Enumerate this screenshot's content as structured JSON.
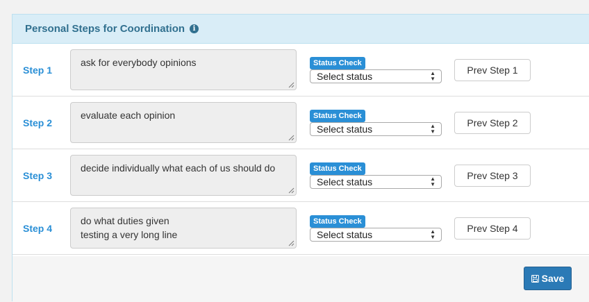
{
  "panel": {
    "title": "Personal Steps for Coordination",
    "info_icon": "info-circle-icon"
  },
  "steps": [
    {
      "label": "Step 1",
      "text": "ask for everybody opinions",
      "status_badge": "Status Check",
      "status_value": "Select status",
      "prev_label": "Prev Step 1"
    },
    {
      "label": "Step 2",
      "text": "evaluate each opinion",
      "status_badge": "Status Check",
      "status_value": "Select status",
      "prev_label": "Prev Step 2"
    },
    {
      "label": "Step 3",
      "text": "decide individually what each of us should do",
      "status_badge": "Status Check",
      "status_value": "Select status",
      "prev_label": "Prev Step 3"
    },
    {
      "label": "Step 4",
      "text": "do what duties given\ntesting a very long line",
      "status_badge": "Status Check",
      "status_value": "Select status",
      "prev_label": "Prev Step 4"
    }
  ],
  "footer": {
    "save_label": "Save",
    "save_icon": "floppy-disk-icon"
  },
  "colors": {
    "accent": "#2a8fd6",
    "heading_bg": "#d9edf7",
    "heading_text": "#31708f",
    "save_bg": "#2b7ab6"
  }
}
